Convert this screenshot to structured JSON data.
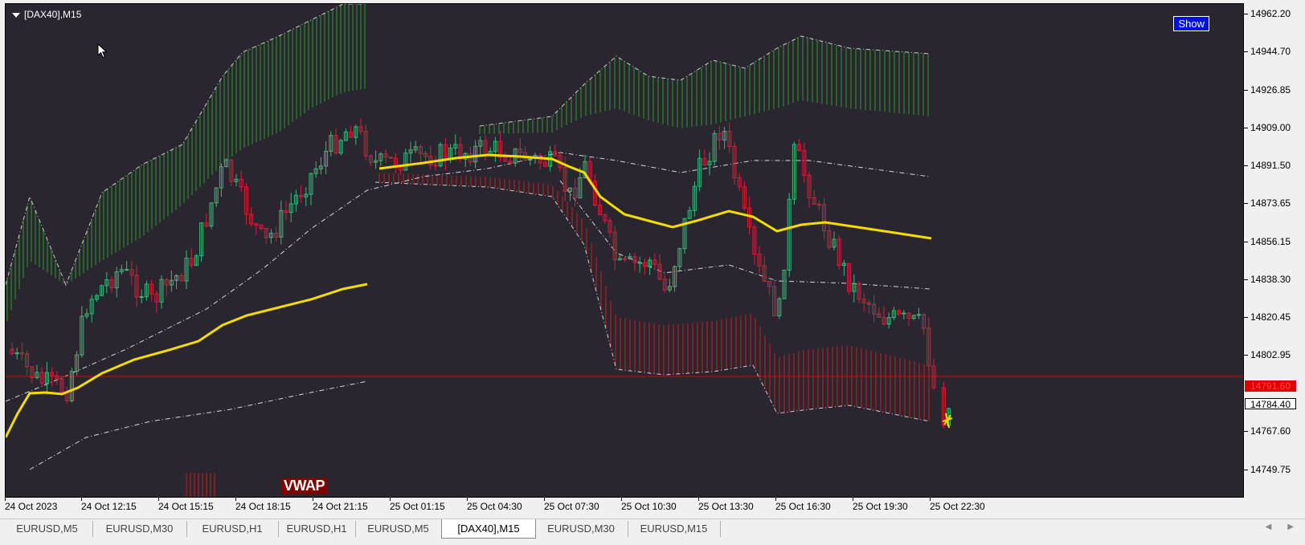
{
  "chart": {
    "symbol": "[DAX40],M15",
    "show_button": "Show",
    "indicator_label": "VWAP",
    "current_price": "14791.60",
    "bid_price": "14784.40"
  },
  "price_axis": [
    "14962.20",
    "14944.70",
    "14926.85",
    "14909.00",
    "14891.50",
    "14873.65",
    "14856.15",
    "14838.30",
    "14820.45",
    "14802.95",
    "14767.60",
    "14749.75"
  ],
  "time_axis": [
    "24 Oct 2023",
    "24 Oct 12:15",
    "24 Oct 15:15",
    "24 Oct 18:15",
    "24 Oct 21:15",
    "25 Oct 01:15",
    "25 Oct 04:30",
    "25 Oct 07:30",
    "25 Oct 10:30",
    "25 Oct 13:30",
    "25 Oct 16:30",
    "25 Oct 19:30",
    "25 Oct 22:30"
  ],
  "tabs": [
    "EURUSD,M5",
    "EURUSD,M30",
    "EURUSD,H1",
    "EURUSD,H1",
    "EURUSD,M5",
    "[DAX40],M15",
    "EURUSD,M30",
    "EURUSD,M15"
  ],
  "active_tab": "[DAX40],M15",
  "colors": {
    "background": "#2a2630",
    "bull_candle": "#3cb878",
    "bear_candle": "#d0203a",
    "vwap_line": "#f5dc00",
    "upper_band": "#2e9a2e",
    "lower_band": "#c81e1e",
    "price_line": "#e00000"
  },
  "icons": {
    "collapse": "triangle-down-icon",
    "cursor": "mouse-pointer-icon",
    "scroll_left": "chevron-left-icon",
    "scroll_right": "chevron-right-icon"
  }
}
